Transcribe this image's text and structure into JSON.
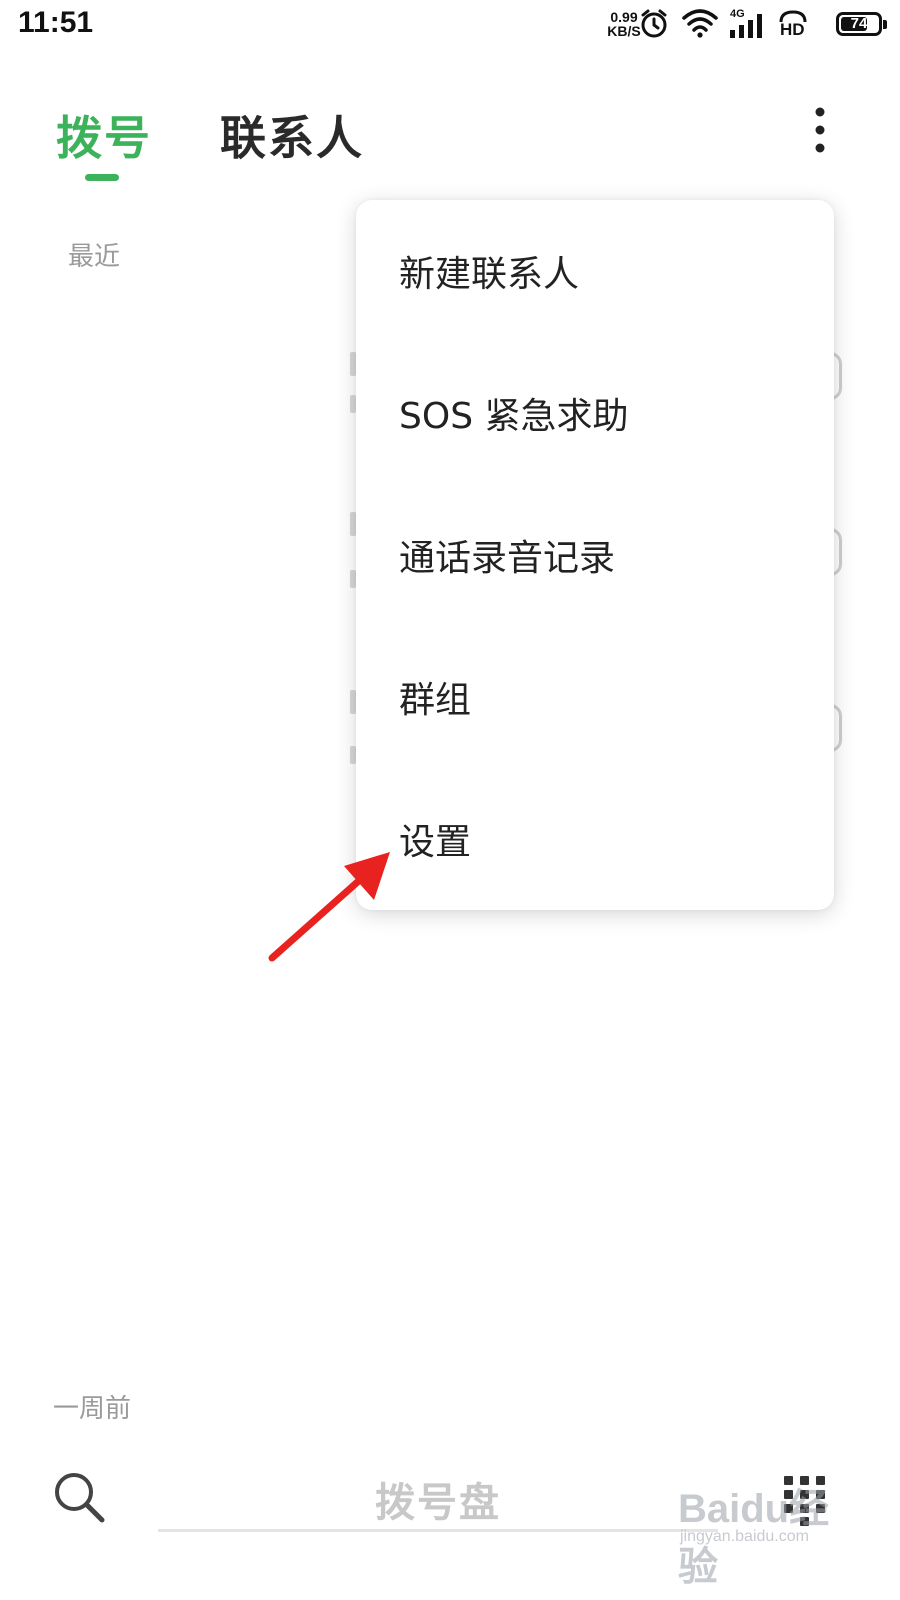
{
  "status_bar": {
    "time": "11:51",
    "net_speed_value": "0.99",
    "net_speed_unit": "KB/S",
    "network_type": "4G",
    "hd_label": "HD",
    "battery_level": "74",
    "icons": [
      "alarm-icon",
      "wifi-icon",
      "signal-icon",
      "hd-voice-icon",
      "battery-icon"
    ]
  },
  "tabs": [
    {
      "label": "拨号",
      "active": true
    },
    {
      "label": "联系人",
      "active": false
    }
  ],
  "colors": {
    "accent": "#3cb35b",
    "annotation": "#e8221f"
  },
  "sections": {
    "recent": "最近",
    "week_ago": "一周前"
  },
  "overflow_menu": {
    "items": [
      {
        "label": "新建联系人"
      },
      {
        "label": "SOS 紧急求助"
      },
      {
        "label": "通话录音记录"
      },
      {
        "label": "群组"
      },
      {
        "label": "设置"
      }
    ]
  },
  "bottom_bar": {
    "dialpad_label": "拨号盘",
    "icons": [
      "search-icon",
      "dialpad-icon"
    ]
  },
  "watermark": {
    "logo": "Baidu经验",
    "sub": "jingyan.baidu.com"
  },
  "battery_fraction": 0.74
}
